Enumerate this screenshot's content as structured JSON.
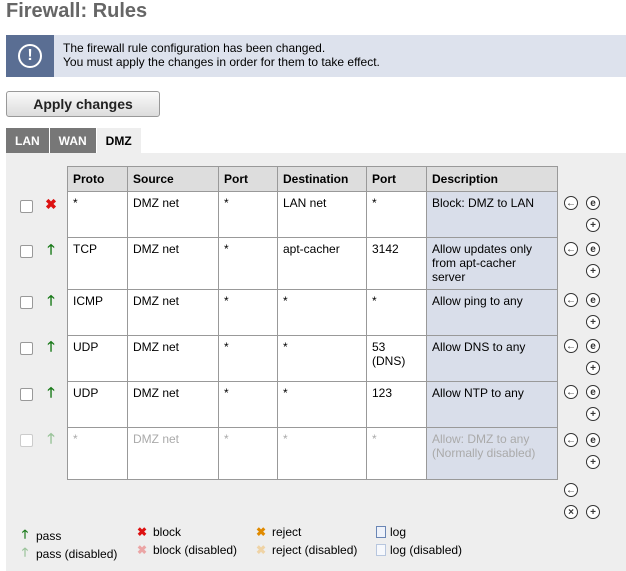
{
  "page": {
    "title": "Firewall: Rules"
  },
  "notice": {
    "icon": "info-icon",
    "line1": "The firewall rule configuration has been changed.",
    "line2": "You must apply the changes in order for them to take effect."
  },
  "apply_button": "Apply changes",
  "tabs": [
    {
      "label": "LAN"
    },
    {
      "label": "WAN"
    },
    {
      "label": "DMZ"
    }
  ],
  "active_tab": "DMZ",
  "table": {
    "headers": [
      "Proto",
      "Source",
      "Port",
      "Destination",
      "Port",
      "Description"
    ],
    "rows": [
      {
        "action": "block",
        "enabled": true,
        "proto": "*",
        "source": "DMZ net",
        "sport": "*",
        "dest": "LAN net",
        "dport": "*",
        "desc": "Block: DMZ to LAN"
      },
      {
        "action": "pass",
        "enabled": true,
        "proto": "TCP",
        "source": "DMZ net",
        "sport": "*",
        "dest": "apt-cacher",
        "dport": "3142",
        "desc": "Allow updates only from apt-cacher server"
      },
      {
        "action": "pass",
        "enabled": true,
        "proto": "ICMP",
        "source": "DMZ net",
        "sport": "*",
        "dest": "*",
        "dport": "*",
        "desc": "Allow ping to any"
      },
      {
        "action": "pass",
        "enabled": true,
        "proto": "UDP",
        "source": "DMZ net",
        "sport": "*",
        "dest": "*",
        "dport": "53 (DNS)",
        "desc": "Allow DNS to any"
      },
      {
        "action": "pass",
        "enabled": true,
        "proto": "UDP",
        "source": "DMZ net",
        "sport": "*",
        "dest": "*",
        "dport": "123",
        "desc": "Allow NTP to any"
      },
      {
        "action": "pass",
        "enabled": false,
        "proto": "*",
        "source": "DMZ net",
        "sport": "*",
        "dest": "*",
        "dport": "*",
        "desc": "Allow: DMZ to any (Normally disabled)"
      }
    ]
  },
  "legend": {
    "pass": "pass",
    "pass_disabled": "pass (disabled)",
    "block": "block",
    "block_disabled": "block (disabled)",
    "reject": "reject",
    "reject_disabled": "reject (disabled)",
    "log": "log",
    "log_disabled": "log (disabled)"
  },
  "colors": {
    "notice_bg": "#dde2ed",
    "notice_icon_bg": "#5a6e93",
    "description_bg": "#d9deea",
    "pass": "#1a7a1a",
    "block": "#dd1111",
    "reject": "#e08a00"
  }
}
